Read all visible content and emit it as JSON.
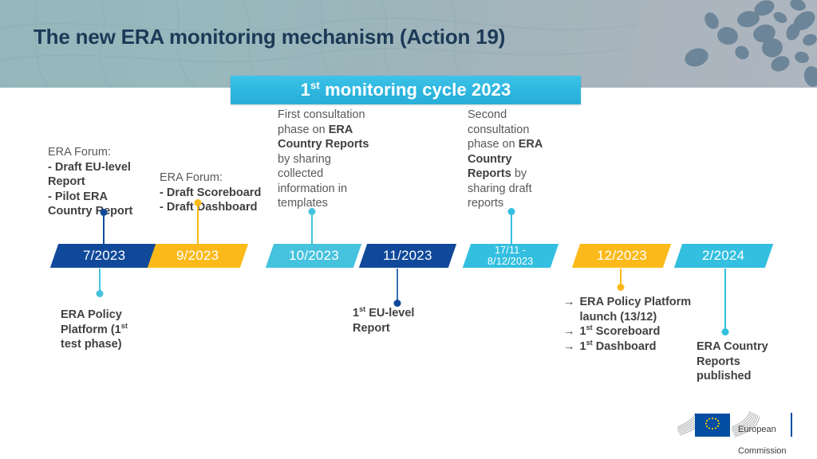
{
  "header": {
    "title": "The new ERA monitoring mechanism (Action 19)",
    "title_color": "#1c3a57",
    "bg_from": "#93b7bc",
    "bg_to": "#aeb6c0"
  },
  "cycle_banner": {
    "prefix": "1",
    "ordinal": "st",
    "suffix": " monitoring cycle 2023",
    "color": "#2fb8e0"
  },
  "colors": {
    "dark_blue": "#10499a",
    "yellow": "#fbba1a",
    "light_blue": "#45c2dd",
    "cyan": "#33bfdf",
    "text_grey": "#58595b",
    "text_dark": "#3f4042"
  },
  "notes_above": [
    {
      "id": "era-forum-1",
      "lines": [
        {
          "text": "ERA Forum:",
          "bold": false
        },
        {
          "text": "- Draft EU-level Report",
          "bold": true
        },
        {
          "text": "- Pilot ERA Country Report",
          "bold": true
        }
      ]
    },
    {
      "id": "era-forum-2",
      "lines": [
        {
          "text": "ERA Forum:",
          "bold": false
        },
        {
          "text": "- Draft Scoreboard",
          "bold": true
        },
        {
          "text": "- Draft Dashboard",
          "bold": true
        }
      ]
    },
    {
      "id": "first-consultation",
      "text_parts": [
        {
          "text": "First consultation phase on ",
          "bold": false
        },
        {
          "text": "ERA Country Reports",
          "bold": true
        },
        {
          "text": " by sharing collected information in templates",
          "bold": false
        }
      ]
    },
    {
      "id": "second-consultation",
      "text_parts": [
        {
          "text": "Second consultation phase on  ",
          "bold": false
        },
        {
          "text": "ERA Country Reports",
          "bold": true
        },
        {
          "text": " by sharing draft reports",
          "bold": false
        }
      ]
    }
  ],
  "timeline": {
    "bars": [
      {
        "id": "bar-7-2023",
        "label": "7/2023",
        "color": "#10499a"
      },
      {
        "id": "bar-9-2023",
        "label": "9/2023",
        "color": "#fbba1a"
      },
      {
        "id": "bar-10-2023",
        "label": "10/2023",
        "color": "#45c2dd"
      },
      {
        "id": "bar-11-2023",
        "label": "11/2023",
        "color": "#10499a"
      },
      {
        "id": "bar-17-11",
        "label": "17/11 -\n8/12/2023",
        "color": "#33bfdf",
        "two_line": true
      },
      {
        "id": "bar-12-2023",
        "label": "12/2023",
        "color": "#fbba1a"
      },
      {
        "id": "bar-2-2024",
        "label": "2/2024",
        "color": "#33bfdf"
      }
    ]
  },
  "notes_below": [
    {
      "id": "era-policy-platform",
      "text_parts": [
        {
          "text": "ERA Policy Platform (1",
          "bold": true
        },
        {
          "text": "st",
          "bold": true,
          "sup": true
        },
        {
          "text": " test phase)",
          "bold": true
        }
      ]
    },
    {
      "id": "eu-level-report",
      "text_parts": [
        {
          "text": "1",
          "bold": true
        },
        {
          "text": "st",
          "bold": true,
          "sup": true
        },
        {
          "text": " EU-level Report",
          "bold": true
        }
      ]
    },
    {
      "id": "december-deliverables",
      "items": [
        {
          "arrow": "→",
          "parts": [
            {
              "text": "ERA Policy Platform launch (13/12)"
            }
          ]
        },
        {
          "arrow": "→",
          "parts": [
            {
              "text": "1"
            },
            {
              "text": "st",
              "sup": true
            },
            {
              "text": " Scoreboard"
            }
          ]
        },
        {
          "arrow": "→",
          "parts": [
            {
              "text": "1"
            },
            {
              "text": "st",
              "sup": true
            },
            {
              "text": " Dashboard"
            }
          ]
        }
      ]
    },
    {
      "id": "country-reports-published",
      "text": "ERA Country Reports published"
    }
  ],
  "logo": {
    "line1": "European",
    "line2": "Commission",
    "flag_color": "#034ea2",
    "star_color": "#ffcc00"
  }
}
